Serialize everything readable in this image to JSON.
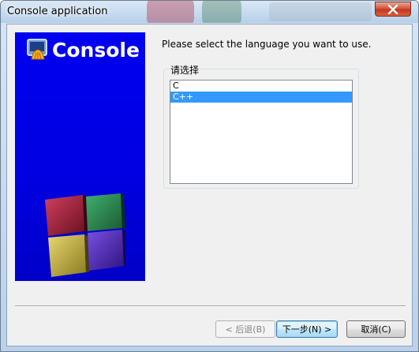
{
  "window": {
    "title": "Console application"
  },
  "side_panel": {
    "title": "Console",
    "background": "#0000e8"
  },
  "main": {
    "instruction": "Please select the language you want to use.",
    "group_label": "请选择",
    "languages": [
      {
        "label": "C",
        "selected": false
      },
      {
        "label": "C++",
        "selected": true
      }
    ]
  },
  "buttons": {
    "back": "< 后退(B)",
    "next": "下一步(N) >",
    "cancel": "取消(C)"
  },
  "icons": {
    "close": "close-icon",
    "logo": "code-blocks-logo-icon"
  },
  "colors": {
    "selection": "#3399ff",
    "close_button": "#c8402a"
  }
}
